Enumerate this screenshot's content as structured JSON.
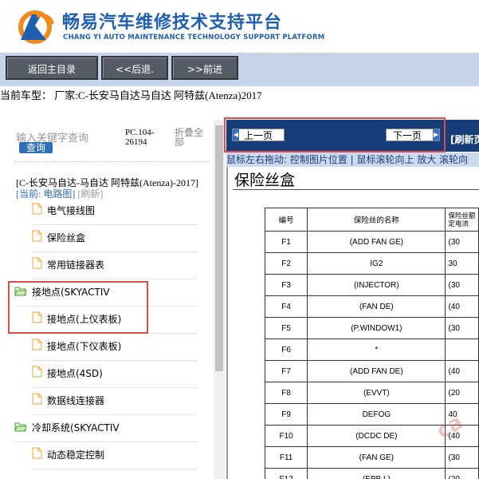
{
  "header": {
    "title_cn": "畅易汽车维修技术支持平台",
    "title_en": "CHANG YI AUTO MAINTENANCE TECHNOLOGY SUPPORT PLATFORM",
    "brand_color": "#1f5fb0"
  },
  "toolbar": {
    "home_label": "返回主目录",
    "back_label": "<<后退.",
    "forward_label": ">>前进"
  },
  "car_info": "当前车型： 厂家:C-长安马自达马自达 阿特兹(Atenza)2017",
  "left_panel": {
    "search_placeholder": "输入关键字查询",
    "search_button": "查询",
    "pc_code": "PC.104-26194",
    "fold_all": "折叠全部",
    "breadcrumb_model": "[C-长安马自达-马自达 阿特兹(Atenza)-2017]",
    "breadcrumb_current_label": "[当前: 电路图]",
    "breadcrumb_refresh": "[刷新]",
    "tree": [
      {
        "label": "电气接线图",
        "type": "file"
      },
      {
        "label": "保险丝盒",
        "type": "file"
      },
      {
        "label": "常用链接器表",
        "type": "file"
      },
      {
        "label": "接地点(SKYACTIV",
        "type": "folder"
      },
      {
        "label": "接地点(上仪表板)",
        "type": "file"
      },
      {
        "label": "接地点(下仪表板)",
        "type": "file"
      },
      {
        "label": "接地点(4SD)",
        "type": "file"
      },
      {
        "label": "数据线连接器",
        "type": "file"
      },
      {
        "label": "冷却系统(SKYACTIV",
        "type": "folder"
      },
      {
        "label": "动态稳定控制",
        "type": "file"
      }
    ]
  },
  "right_panel": {
    "prev_page": "上一页",
    "next_page": "下一页",
    "refresh": "[刷新页",
    "hint": "鼠标左右拖动: 控制图片位置 | 鼠标滚轮向上 放大  滚轮向",
    "doc_title": "保险丝盒",
    "table_headers": [
      "编号",
      "保险丝的名称",
      "保险丝额定电流"
    ],
    "table_rows": [
      {
        "no": "F1",
        "name": "(ADD FAN GE)",
        "rate": "(30"
      },
      {
        "no": "F2",
        "name": "IG2",
        "rate": "30"
      },
      {
        "no": "F3",
        "name": "(INJECTOR)",
        "rate": "(30"
      },
      {
        "no": "F4",
        "name": "(FAN DE)",
        "rate": "(40"
      },
      {
        "no": "F5",
        "name": "(P.WINDOW1)",
        "rate": "(30"
      },
      {
        "no": "F6",
        "name": "*",
        "rate": ""
      },
      {
        "no": "F7",
        "name": "(ADD FAN DE)",
        "rate": "(40"
      },
      {
        "no": "F8",
        "name": "(EVVT)",
        "rate": "(20"
      },
      {
        "no": "F9",
        "name": "DEFOG",
        "rate": "40"
      },
      {
        "no": "F10",
        "name": "(DCDC DE)",
        "rate": "(40"
      },
      {
        "no": "F11",
        "name": "(FAN GE)",
        "rate": "(30"
      },
      {
        "no": "F12",
        "name": "(EPB L)",
        "rate": "(20"
      }
    ]
  },
  "watermark": "ca"
}
